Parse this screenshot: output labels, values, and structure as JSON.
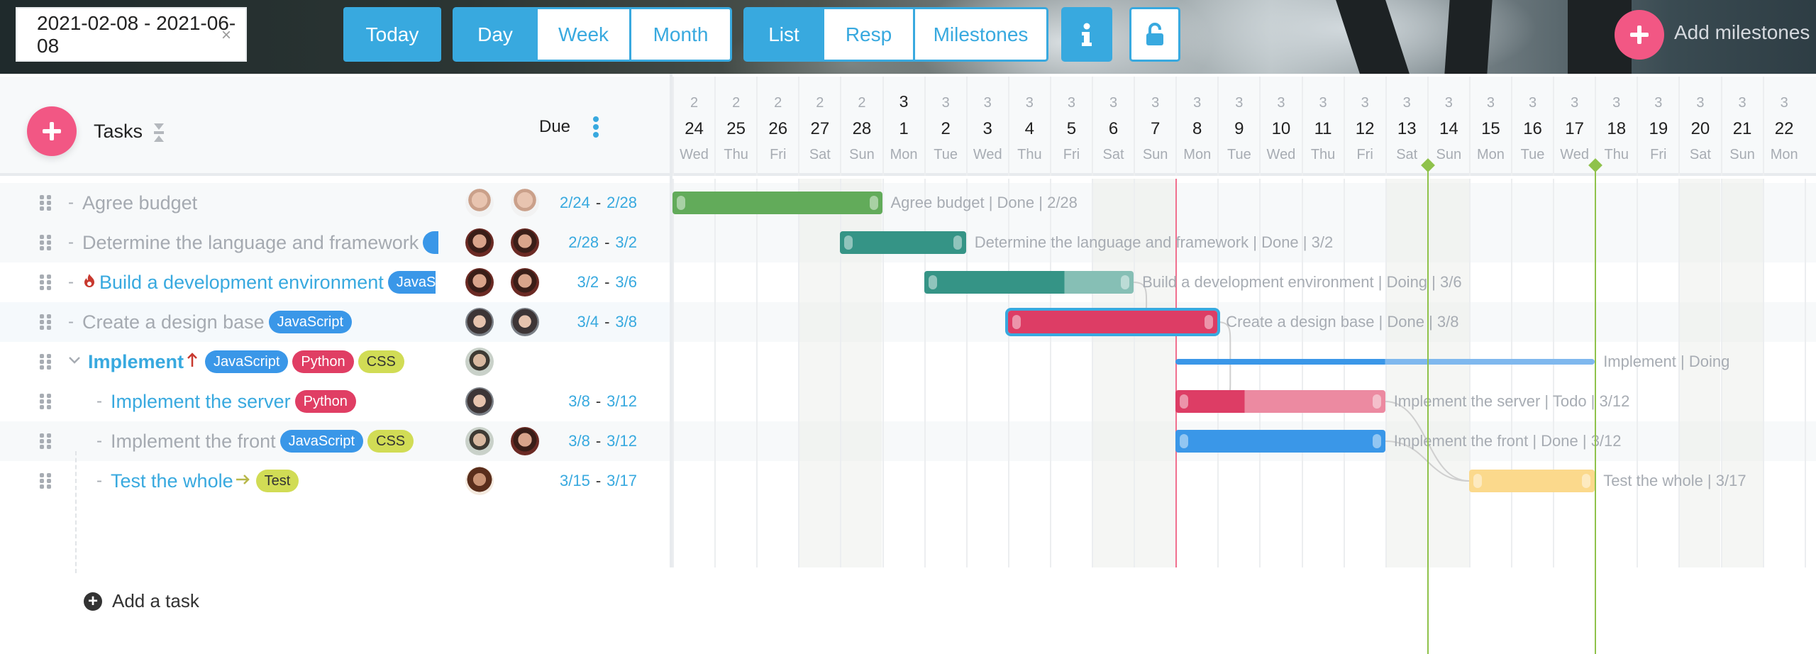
{
  "toolbar": {
    "date_range": "2021-02-08 - 2021-06-08",
    "clear_icon": "×",
    "today_label": "Today",
    "scale_tabs": [
      {
        "label": "Day",
        "active": true
      },
      {
        "label": "Week",
        "active": false
      },
      {
        "label": "Month",
        "active": false
      }
    ],
    "view_tabs": [
      {
        "label": "List",
        "active": true
      },
      {
        "label": "Resp",
        "active": false
      },
      {
        "label": "Milestones",
        "active": false
      }
    ],
    "info_icon": "info-icon",
    "lock_icon": "unlock-icon",
    "add_milestones_label": "Add milestones"
  },
  "list": {
    "tasks_header": "Tasks",
    "due_header": "Due",
    "add_task_label": "Add a task",
    "rows": [
      {
        "name": "Agree budget",
        "state": "done",
        "tags": [],
        "avatars": [
          "av-bald",
          "av-bald"
        ],
        "start": "2/24",
        "end": "2/28",
        "indent": 0
      },
      {
        "name": "Determine the language and framework",
        "state": "done",
        "tags": [
          "js-cut"
        ],
        "avatars": [
          "av-glasses",
          "av-glasses"
        ],
        "start": "2/28",
        "end": "3/2",
        "indent": 0
      },
      {
        "name": "Build a development environment",
        "state": "active",
        "icon": "fire-icon",
        "tags": [
          "js-cut2"
        ],
        "avatars": [
          "av-glasses",
          "av-glasses"
        ],
        "start": "3/2",
        "end": "3/6",
        "indent": 0
      },
      {
        "name": "Create a design base",
        "state": "done",
        "tags": [
          "JavaScript"
        ],
        "avatars": [
          "av-woman",
          "av-woman"
        ],
        "start": "3/4",
        "end": "3/8",
        "indent": 0
      },
      {
        "name": "Implement",
        "state": "active",
        "bold": true,
        "icon": "arrow-up-icon",
        "collapse": true,
        "tags": [
          "JavaScript",
          "Python",
          "CSS"
        ],
        "avatars": [
          "av-beard"
        ],
        "start": "",
        "end": "",
        "indent": 0
      },
      {
        "name": "Implement the server",
        "state": "active",
        "tags": [
          "Python"
        ],
        "avatars": [
          "av-woman"
        ],
        "start": "3/8",
        "end": "3/12",
        "indent": 1
      },
      {
        "name": "Implement the front",
        "state": "done",
        "tags": [
          "JavaScript",
          "CSS"
        ],
        "avatars": [
          "av-beard",
          "av-glasses"
        ],
        "start": "3/8",
        "end": "3/12",
        "indent": 1
      },
      {
        "name": "Test the whole",
        "state": "active",
        "icon": "arrow-right-icon",
        "tags": [
          "Test"
        ],
        "avatars": [
          "av-curly"
        ],
        "start": "3/15",
        "end": "3/17",
        "indent": 1
      }
    ]
  },
  "timeline": {
    "days": [
      {
        "m": "2",
        "d": "24",
        "w": "Wed"
      },
      {
        "m": "2",
        "d": "25",
        "w": "Thu"
      },
      {
        "m": "2",
        "d": "26",
        "w": "Fri"
      },
      {
        "m": "2",
        "d": "27",
        "w": "Sat"
      },
      {
        "m": "2",
        "d": "28",
        "w": "Sun"
      },
      {
        "m": "3",
        "d": "1",
        "w": "Mon",
        "first": true
      },
      {
        "m": "3",
        "d": "2",
        "w": "Tue"
      },
      {
        "m": "3",
        "d": "3",
        "w": "Wed"
      },
      {
        "m": "3",
        "d": "4",
        "w": "Thu"
      },
      {
        "m": "3",
        "d": "5",
        "w": "Fri"
      },
      {
        "m": "3",
        "d": "6",
        "w": "Sat"
      },
      {
        "m": "3",
        "d": "7",
        "w": "Sun"
      },
      {
        "m": "3",
        "d": "8",
        "w": "Mon"
      },
      {
        "m": "3",
        "d": "9",
        "w": "Tue"
      },
      {
        "m": "3",
        "d": "10",
        "w": "Wed"
      },
      {
        "m": "3",
        "d": "11",
        "w": "Thu"
      },
      {
        "m": "3",
        "d": "12",
        "w": "Fri"
      },
      {
        "m": "3",
        "d": "13",
        "w": "Sat"
      },
      {
        "m": "3",
        "d": "14",
        "w": "Sun"
      },
      {
        "m": "3",
        "d": "15",
        "w": "Mon"
      },
      {
        "m": "3",
        "d": "16",
        "w": "Tue"
      },
      {
        "m": "3",
        "d": "17",
        "w": "Wed"
      },
      {
        "m": "3",
        "d": "18",
        "w": "Thu"
      },
      {
        "m": "3",
        "d": "19",
        "w": "Fri"
      },
      {
        "m": "3",
        "d": "20",
        "w": "Sat"
      },
      {
        "m": "3",
        "d": "21",
        "w": "Sun"
      },
      {
        "m": "3",
        "d": "22",
        "w": "Mon"
      }
    ],
    "today_index": 12,
    "milestones": [
      18,
      22
    ],
    "bars": [
      {
        "row": 0,
        "start": 0,
        "end": 5,
        "color": "#62ab5a",
        "light": "#62ab5a",
        "progress": 1.0,
        "label": "Agree budget | Done | 2/28"
      },
      {
        "row": 1,
        "start": 4,
        "end": 7,
        "color": "#359486",
        "light": "#359486",
        "progress": 1.0,
        "label": "Determine the language and framework | Done | 3/2"
      },
      {
        "row": 2,
        "start": 6,
        "end": 11,
        "color": "#359486",
        "light": "#86bfb5",
        "progress": 0.67,
        "label": "Build a development environment | Doing | 3/6"
      },
      {
        "row": 3,
        "start": 8,
        "end": 13,
        "color": "#dd3d65",
        "light": "#dd3d65",
        "progress": 1.0,
        "label": "Create a design base | Done | 3/8",
        "selected": true
      },
      {
        "row": 5,
        "start": 12,
        "end": 17,
        "color": "#dd3d65",
        "light": "#ec8aa1",
        "progress": 0.33,
        "label": "Implement the server | Todo | 3/12"
      },
      {
        "row": 6,
        "start": 12,
        "end": 17,
        "color": "#3a97e8",
        "light": "#3a97e8",
        "progress": 1.0,
        "label": "Implement the front | Done | 3/12"
      },
      {
        "row": 7,
        "start": 19,
        "end": 22,
        "color": "#fbd98c",
        "light": "#fbd98c",
        "progress": 1.0,
        "label": "Test the whole | 3/17"
      }
    ],
    "summary": {
      "row": 4,
      "start": 12,
      "end": 22,
      "color": "#3a97e8",
      "light": "#7fb8ee",
      "progress": 0.5,
      "label": "Implement | Doing"
    },
    "links": [
      [
        2,
        3
      ],
      [
        3,
        5
      ],
      [
        5,
        7
      ],
      [
        6,
        7
      ]
    ]
  },
  "colors": {
    "accent": "#38a9df",
    "pink": "#f25784",
    "js": "#3a97e8",
    "python": "#e03e64",
    "css": "#d1dc55",
    "milestone": "#8fc24b",
    "today": "#f0708e"
  }
}
